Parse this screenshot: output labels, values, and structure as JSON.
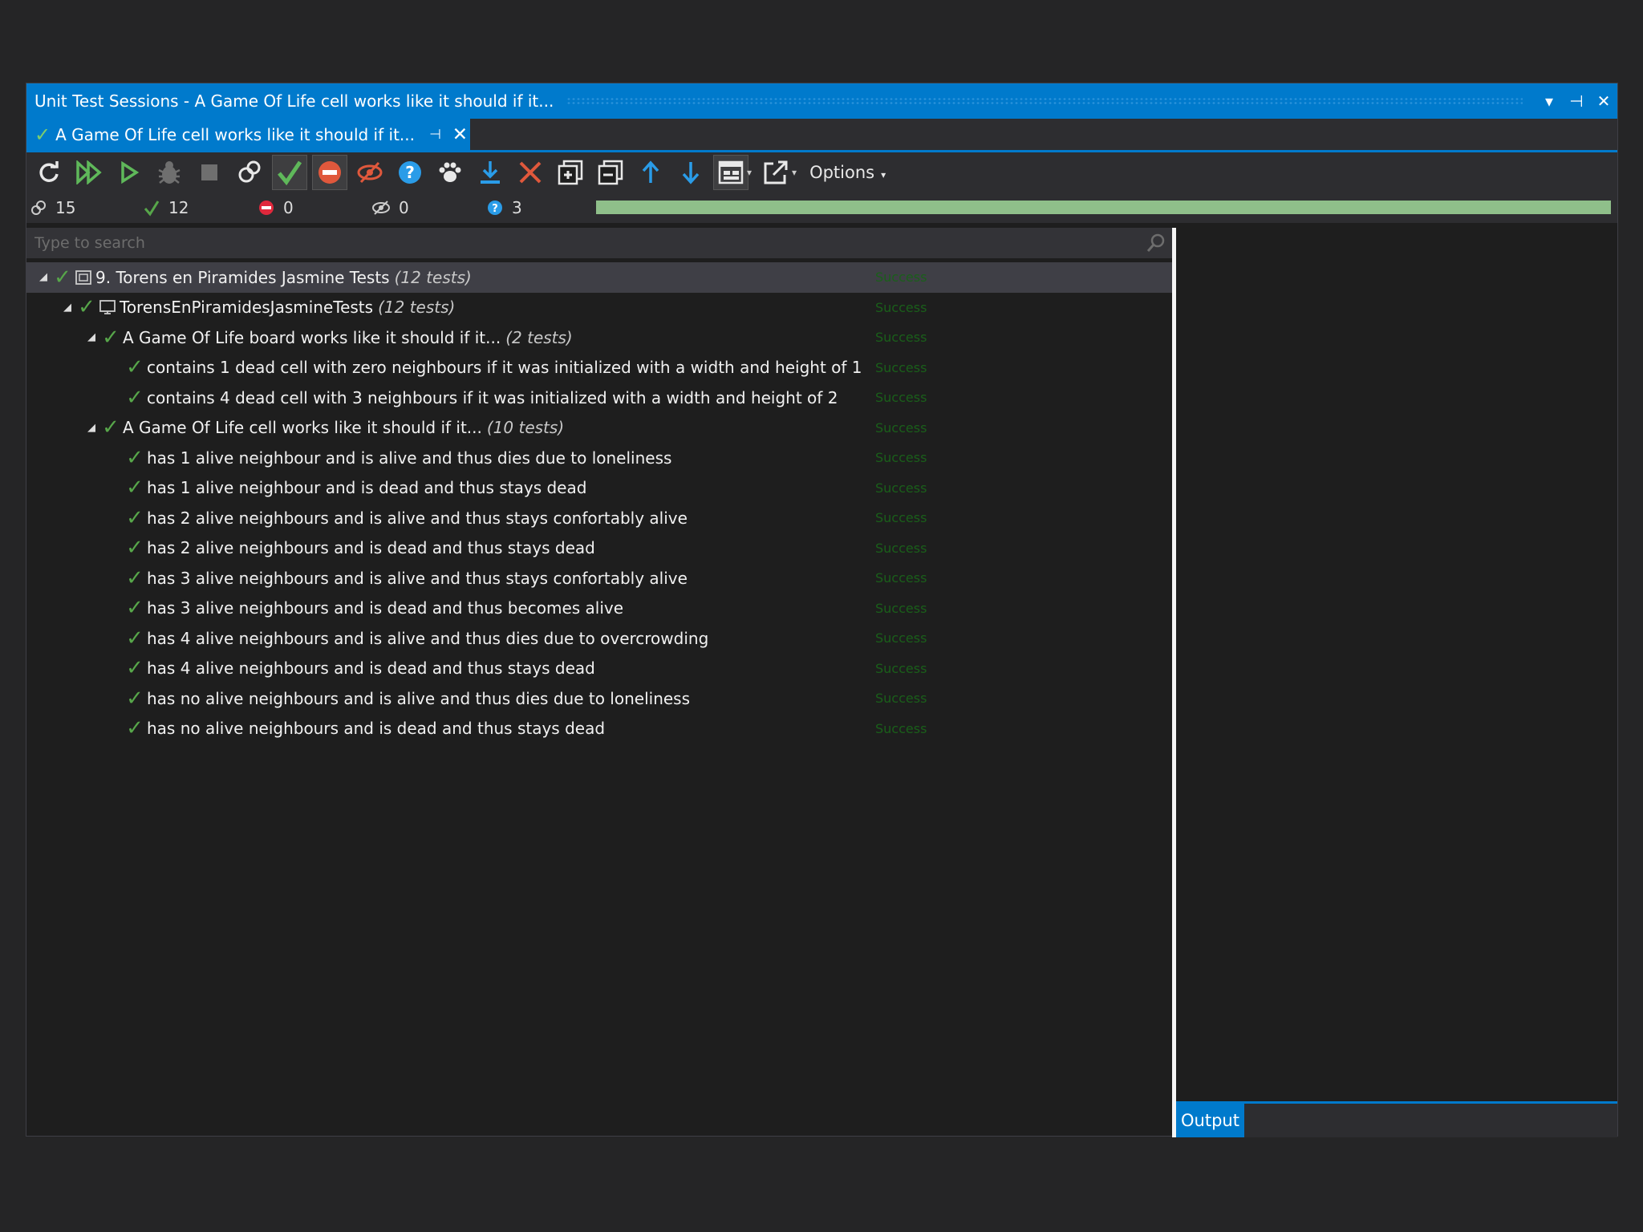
{
  "window": {
    "title": "Unit Test Sessions - A Game Of Life cell works like it should if it...",
    "buttons": {
      "dropdown": "▾",
      "pin": "⊣",
      "close": "✕"
    }
  },
  "tab": {
    "label": "A Game Of Life cell works like it should if it...",
    "pin": "⊣",
    "close": "✕"
  },
  "toolbar": {
    "options_label": "Options",
    "icons": [
      "refresh-icon",
      "run-all-icon",
      "run-icon",
      "debug-icon",
      "stop-icon",
      "show-all-icon",
      "show-passed-icon",
      "show-failed-icon",
      "show-ignored-icon",
      "show-inconclusive-icon",
      "track-running-icon",
      "export-icon",
      "delete-icon",
      "expand-all-icon",
      "collapse-all-icon",
      "previous-icon",
      "next-icon",
      "layout-icon",
      "open-external-icon"
    ]
  },
  "counts": {
    "total": "15",
    "passed": "12",
    "failed": "0",
    "ignored": "0",
    "inconclusive": "3"
  },
  "progress_fraction": 1.0,
  "search": {
    "placeholder": "Type to search"
  },
  "tree": {
    "root": {
      "label": "9. Torens en Piramides Jasmine Tests",
      "count": "(12 tests)",
      "status": "Success"
    },
    "suite": {
      "label": "TorensEnPiramidesJasmineTests",
      "count": "(12 tests)",
      "status": "Success"
    },
    "board": {
      "label": "A Game Of Life board works like it should if it...",
      "count": "(2 tests)",
      "status": "Success",
      "tests": [
        {
          "label": "contains 1 dead cell with zero neighbours if it was initialized with a width and height of 1",
          "status": "Success"
        },
        {
          "label": "contains 4 dead cell with 3 neighbours if it was initialized with a width and height of 2",
          "status": "Success"
        }
      ]
    },
    "cell": {
      "label": "A Game Of Life cell works like it should if it...",
      "count": "(10 tests)",
      "status": "Success",
      "tests": [
        {
          "label": "has 1 alive neighbour and is alive and thus dies due to loneliness",
          "status": "Success"
        },
        {
          "label": "has 1 alive neighbour and is dead and thus stays dead",
          "status": "Success"
        },
        {
          "label": "has 2 alive neighbours and is alive and thus stays confortably alive",
          "status": "Success"
        },
        {
          "label": "has 2 alive neighbours and is dead and thus stays dead",
          "status": "Success"
        },
        {
          "label": "has 3 alive neighbours and is alive and thus stays confortably alive",
          "status": "Success"
        },
        {
          "label": "has 3 alive neighbours and is dead and thus becomes alive",
          "status": "Success"
        },
        {
          "label": "has 4 alive neighbours and is alive and thus dies due to overcrowding",
          "status": "Success"
        },
        {
          "label": "has 4 alive neighbours and is dead and thus stays dead",
          "status": "Success"
        },
        {
          "label": "has no alive neighbours and is alive and thus dies due to loneliness",
          "status": "Success"
        },
        {
          "label": "has no alive neighbours and is dead and thus stays dead",
          "status": "Success"
        }
      ]
    }
  },
  "output": {
    "tab_label": "Output"
  },
  "colors": {
    "accent": "#007acc",
    "success": "#57a64a",
    "background": "#1e1e1e",
    "chrome": "#2d2d30",
    "progress": "#8fbf8a"
  }
}
